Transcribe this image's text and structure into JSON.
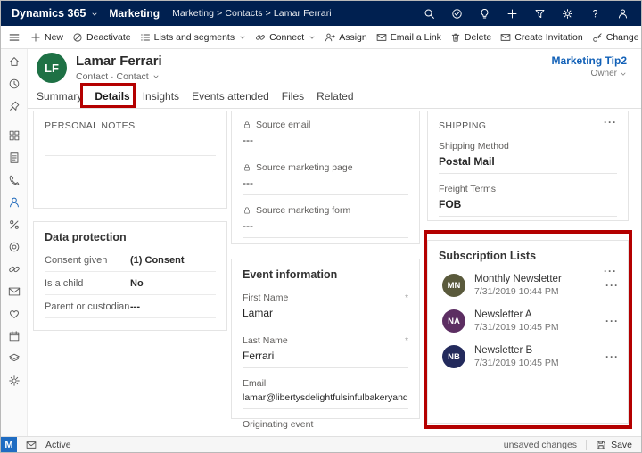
{
  "topbar": {
    "brand": "Dynamics 365",
    "app": "Marketing",
    "breadcrumb": "Marketing  >  Contacts  >  Lamar Ferrari"
  },
  "command_bar": {
    "new": "New",
    "deactivate": "Deactivate",
    "lists_segments": "Lists and segments",
    "connect": "Connect",
    "assign": "Assign",
    "email_link": "Email a Link",
    "delete": "Delete",
    "create_invitation": "Create Invitation",
    "change_password": "Change Password",
    "more": "···"
  },
  "header": {
    "initials": "LF",
    "name": "Lamar Ferrari",
    "subtitle": "Contact · Contact",
    "owner_name": "Marketing Tip2",
    "owner_role": "Owner"
  },
  "tabs": {
    "summary": "Summary",
    "details": "Details",
    "insights": "Insights",
    "events": "Events attended",
    "files": "Files",
    "related": "Related"
  },
  "personal_notes": {
    "title": "PERSONAL NOTES"
  },
  "data_protection": {
    "title": "Data protection",
    "rows": [
      {
        "label": "Consent given",
        "value": "(1) Consent"
      },
      {
        "label": "Is a child",
        "value": "No"
      },
      {
        "label": "Parent or custodian",
        "value": "---"
      }
    ]
  },
  "source_fields": {
    "rows": [
      {
        "label": "Source email",
        "value": "---"
      },
      {
        "label": "Source marketing page",
        "value": "---"
      },
      {
        "label": "Source marketing form",
        "value": "---"
      }
    ]
  },
  "event_information": {
    "title": "Event information",
    "required_marker": "*",
    "fields": [
      {
        "label": "First Name",
        "value": "Lamar"
      },
      {
        "label": "Last Name",
        "value": "Ferrari"
      },
      {
        "label": "Email",
        "value": "lamar@libertysdelightfulsinfulbakeryandcaf"
      },
      {
        "label": "Originating event",
        "value": "---"
      }
    ]
  },
  "shipping": {
    "title": "SHIPPING",
    "more": "···",
    "rows": [
      {
        "label": "Shipping Method",
        "value": "Postal Mail"
      },
      {
        "label": "Freight Terms",
        "value": "FOB"
      }
    ]
  },
  "subscription_lists": {
    "title": "Subscription Lists",
    "more": "···",
    "item_more": "···",
    "items": [
      {
        "initials": "MN",
        "name": "Monthly Newsletter",
        "date": "7/31/2019 10:44 PM",
        "color": "#5a5a3c"
      },
      {
        "initials": "NA",
        "name": "Newsletter A",
        "date": "7/31/2019 10:45 PM",
        "color": "#5c2e62"
      },
      {
        "initials": "NB",
        "name": "Newsletter B",
        "date": "7/31/2019 10:45 PM",
        "color": "#232a5c"
      }
    ]
  },
  "status_bar": {
    "m_badge": "M",
    "state": "Active",
    "unsaved": "unsaved changes",
    "save": "Save"
  },
  "colors": {
    "topbar_bg": "#002050",
    "accent": "#1160b7",
    "annotation": "#b40000",
    "avatar_bg": "#1e7145",
    "m_badge_bg": "#1f6cc2"
  }
}
